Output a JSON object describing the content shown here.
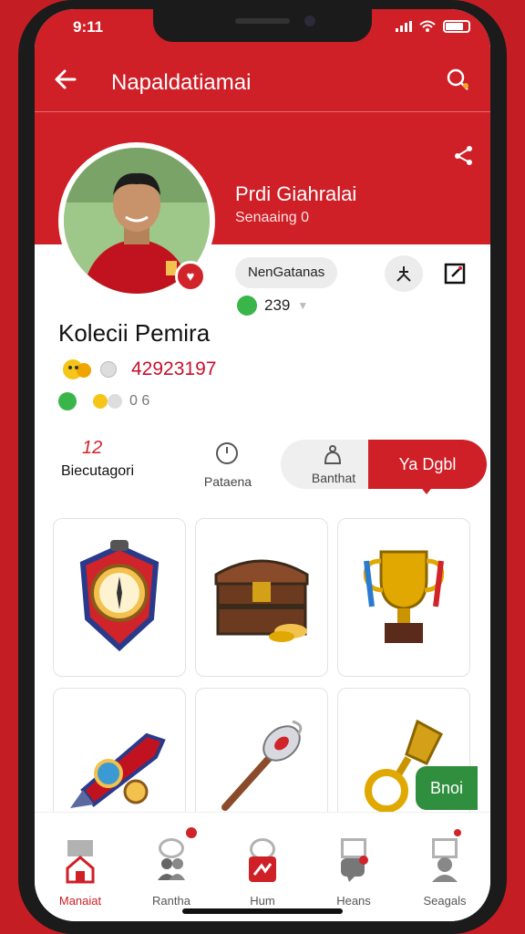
{
  "status": {
    "time": "9:11"
  },
  "appbar": {
    "title": "Napaldatiamai",
    "back_icon": "arrow-left-icon",
    "search_icon": "search-icon"
  },
  "profile": {
    "name": "Prdi Giahralai",
    "subtitle": "Senaaing 0",
    "chip": "NenGatanas",
    "followers": "239",
    "display_name": "Kolecii Pemira",
    "score": "42923197",
    "coins": "0 6"
  },
  "tabs": [
    {
      "label": "Biecutagori",
      "badge": "12"
    },
    {
      "label": "Pataena"
    },
    {
      "label": "Banthat"
    },
    {
      "label": "Ya Dgbl",
      "active": true
    }
  ],
  "items": [
    {
      "name": "compass-shield"
    },
    {
      "name": "treasure-chest"
    },
    {
      "name": "golden-trophy"
    },
    {
      "name": "rocket-gadget"
    },
    {
      "name": "silver-wand"
    },
    {
      "name": "golden-hook"
    }
  ],
  "tag": {
    "label": "Bnoi"
  },
  "nav": [
    {
      "label": "Manaiat",
      "icon": "home-icon",
      "active": true
    },
    {
      "label": "Rantha",
      "icon": "people-icon"
    },
    {
      "label": "Hum",
      "icon": "flag-icon"
    },
    {
      "label": "Heans",
      "icon": "chat-icon"
    },
    {
      "label": "Seagals",
      "icon": "user-icon"
    }
  ],
  "colors": {
    "brand": "#cf1f27",
    "success": "#2f8f3e"
  }
}
